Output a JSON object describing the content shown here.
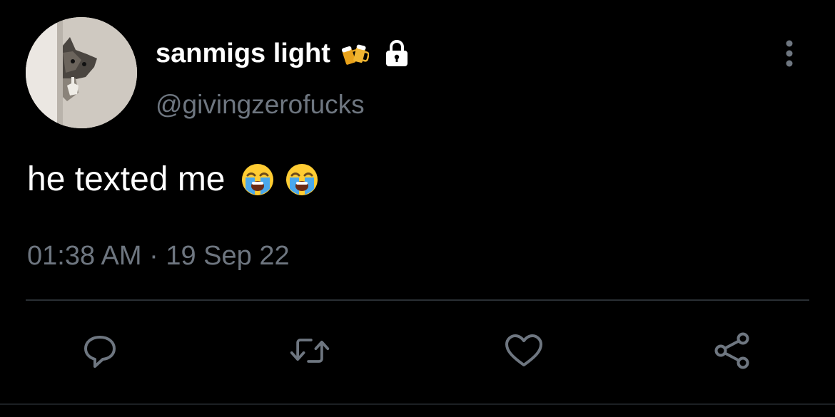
{
  "tweet": {
    "author": {
      "display_name": "sanmigs light",
      "handle": "@givingzerofucks",
      "avatar_icon": "cat-peeking-avatar",
      "name_badge_icon": "beer-mugs-emoji",
      "protected_icon": "lock-icon"
    },
    "text": "he texted me",
    "text_emojis": [
      "loudly-crying-face-emoji",
      "loudly-crying-face-emoji"
    ],
    "timestamp": "01:38 AM · 19 Sep 22",
    "actions": [
      {
        "name": "reply",
        "icon": "reply-icon"
      },
      {
        "name": "retweet",
        "icon": "retweet-icon"
      },
      {
        "name": "like",
        "icon": "heart-icon"
      },
      {
        "name": "share",
        "icon": "share-icon"
      }
    ]
  },
  "colors": {
    "background": "#000000",
    "primary_text": "#ffffff",
    "secondary_text": "#6e7680",
    "icon": "#6e7680",
    "divider": "#2a2f34"
  }
}
